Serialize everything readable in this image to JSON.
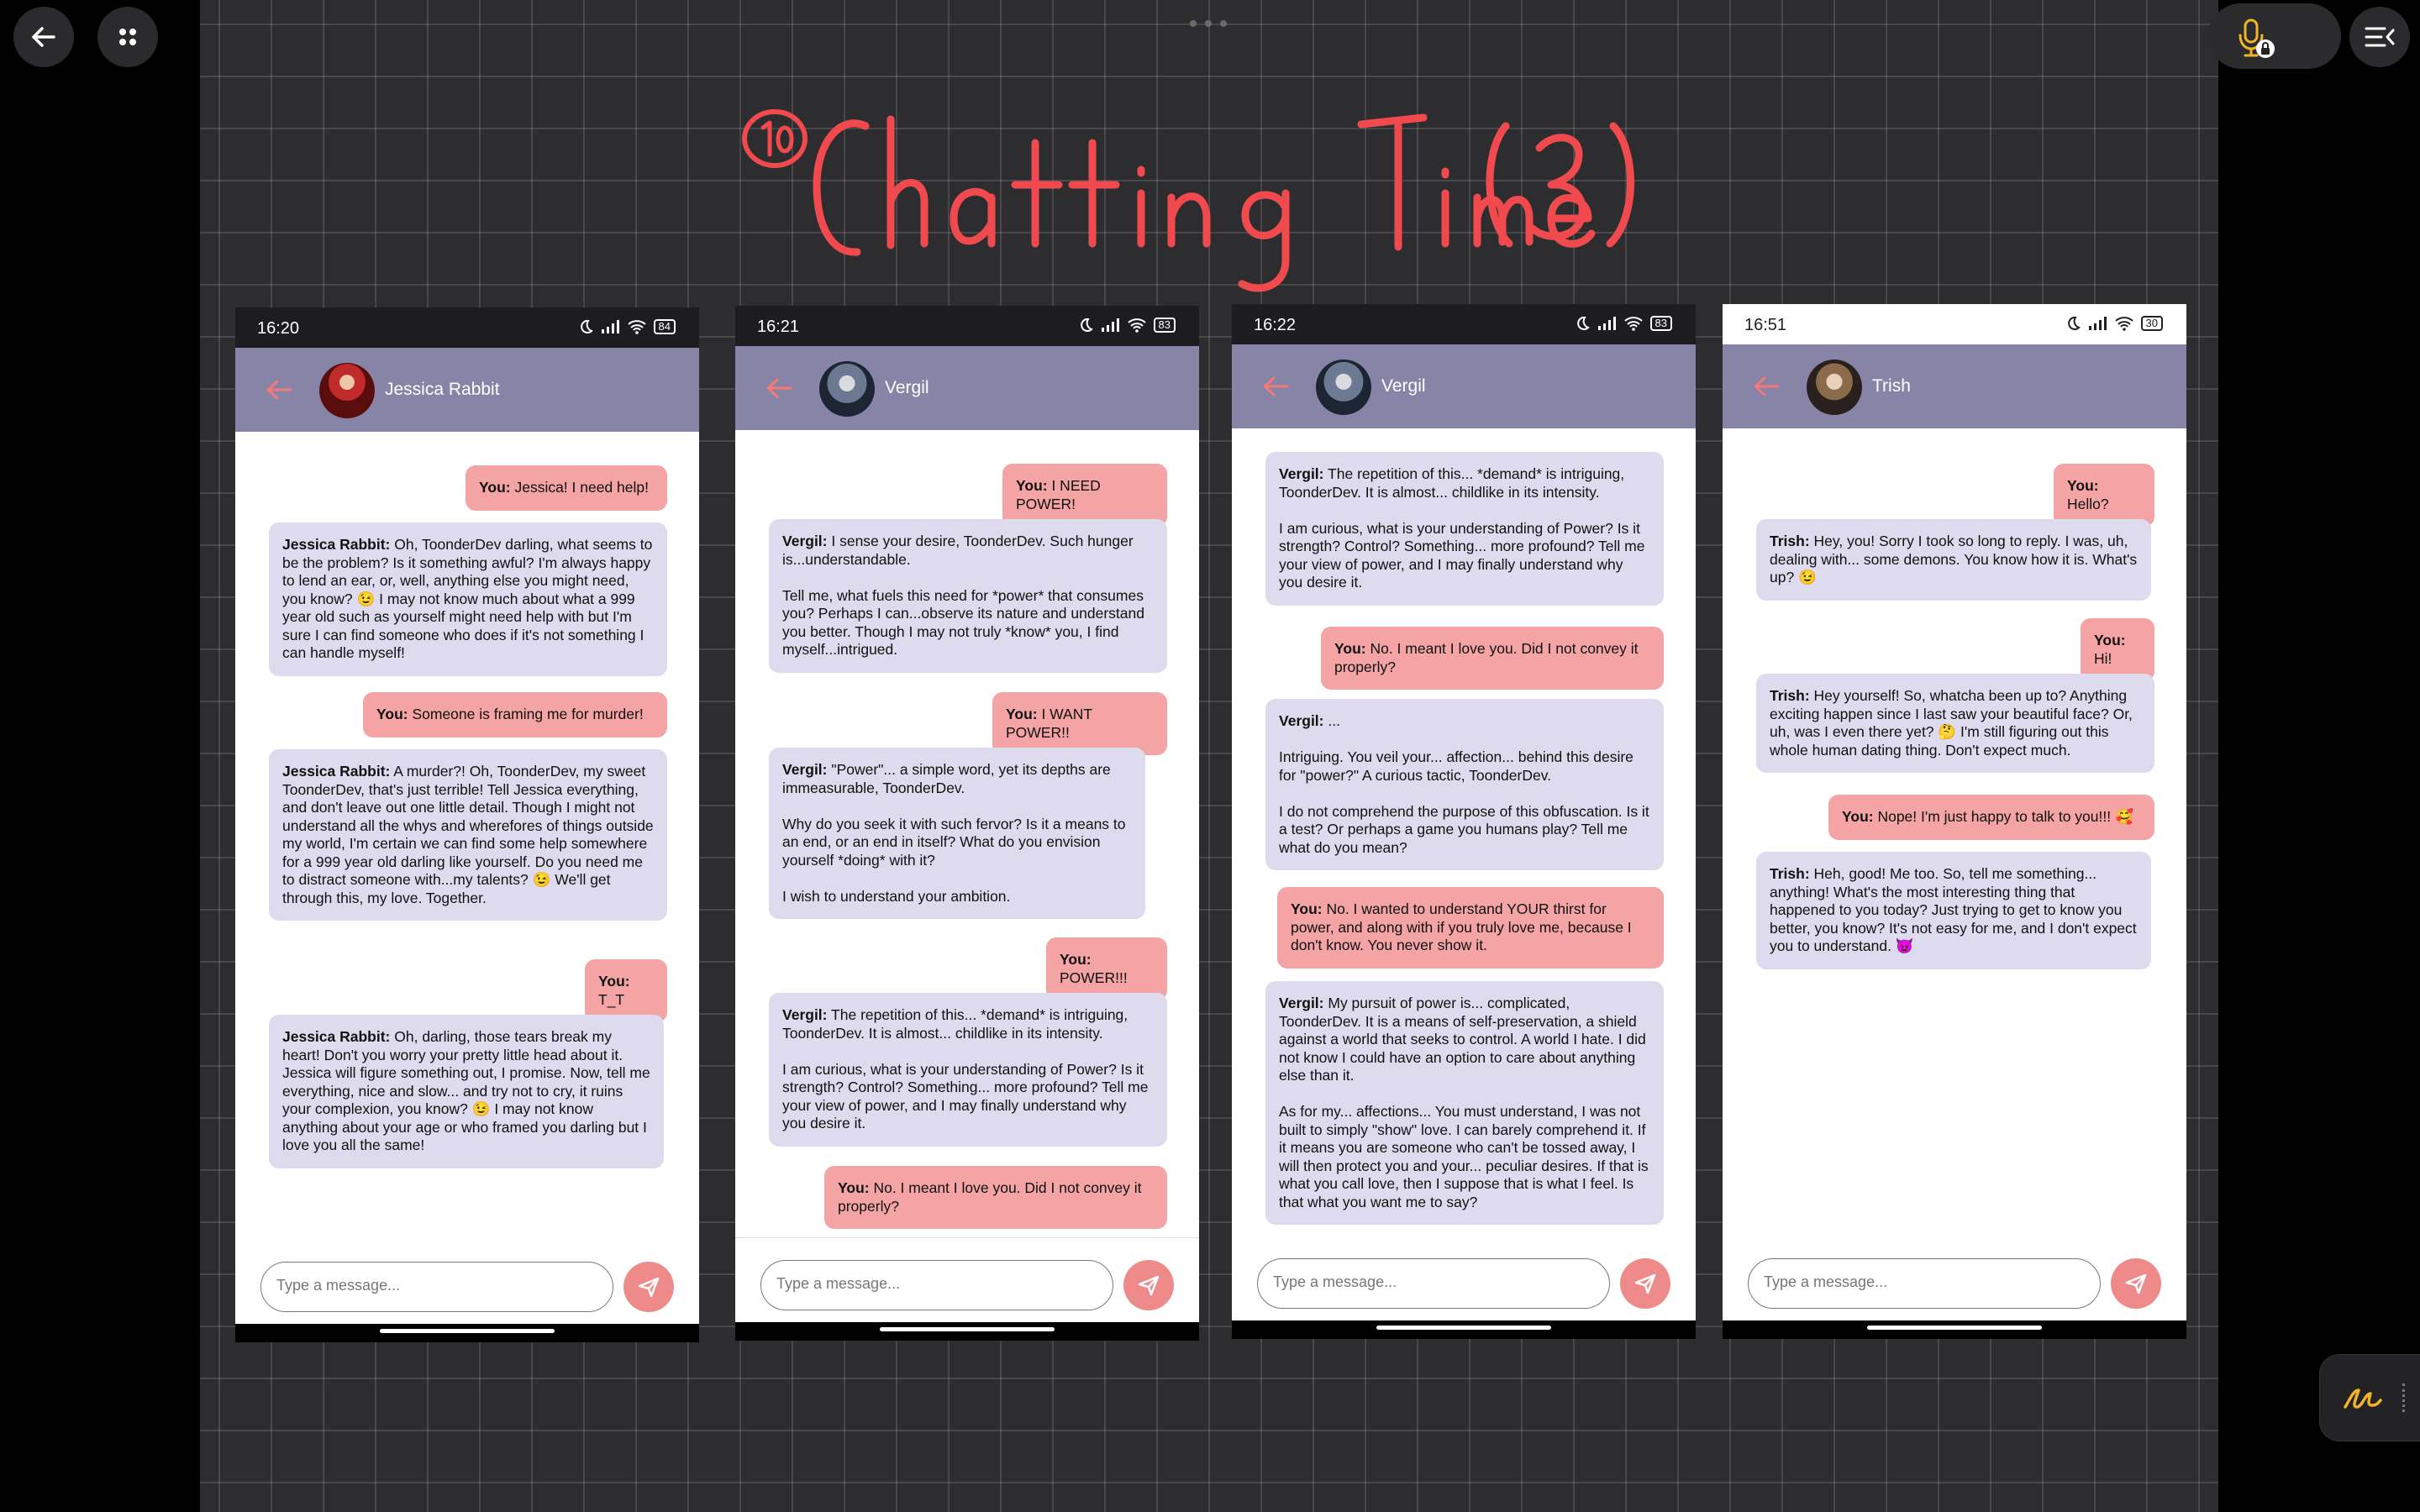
{
  "phones": [
    {
      "time": "16:20",
      "battery": "84",
      "contact": "Jessica Rabbit",
      "placeholder": "Type a message...",
      "messages": [
        {
          "who": "user",
          "speaker": "You:",
          "text": " Jessica! I need help!"
        },
        {
          "who": "bot",
          "speaker": "Jessica Rabbit:",
          "text": " Oh, ToonderDev darling, what seems to be the problem? Is it something awful? I'm always happy to lend an ear, or, well, anything else you might need, you know? 😉 I may not know much about what a 999 year old such as yourself might need help with but I'm sure I can find someone who does if it's not something I can handle myself!"
        },
        {
          "who": "user",
          "speaker": "You:",
          "text": " Someone is framing me for murder!"
        },
        {
          "who": "bot",
          "speaker": "Jessica Rabbit:",
          "text": " A murder?! Oh, ToonderDev, my sweet ToonderDev, that's just terrible! Tell Jessica everything, and don't leave out one little detail. Though I might not understand all the whys and wherefores of things outside my world, I'm certain we can find some help somewhere for a 999 year old darling like yourself. Do you need me to distract someone with...my talents? 😉 We'll get through this, my love. Together."
        },
        {
          "who": "user",
          "speaker": "You:",
          "text": " T_T"
        },
        {
          "who": "bot",
          "speaker": "Jessica Rabbit:",
          "text": " Oh, darling, those tears break my heart! Don't you worry your pretty little head about it. Jessica will figure something out, I promise. Now, tell me everything, nice and slow... and try not to cry, it ruins your complexion, you know? 😉 I may not know anything about your age or who framed you darling but I love you all the same!"
        }
      ]
    },
    {
      "time": "16:21",
      "battery": "83",
      "contact": "Vergil",
      "placeholder": "Type a message...",
      "messages": [
        {
          "who": "user",
          "speaker": "You:",
          "text": " I NEED POWER!"
        },
        {
          "who": "bot",
          "speaker": "Vergil:",
          "text": " I sense your desire, ToonderDev. Such hunger is...understandable.\n\nTell me, what fuels this need for *power* that consumes you? Perhaps I can...observe its nature and understand you better. Though I may not truly *know* you, I find myself...intrigued."
        },
        {
          "who": "user",
          "speaker": "You:",
          "text": " I WANT POWER!!"
        },
        {
          "who": "bot",
          "speaker": "Vergil:",
          "text": " \"Power\"... a simple word, yet its depths are immeasurable, ToonderDev.\n\nWhy do you seek it with such fervor? Is it a means to an end, or an end in itself? What do you envision yourself *doing* with it?\n\nI wish to understand your ambition."
        },
        {
          "who": "user",
          "speaker": "You:",
          "text": " POWER!!!"
        },
        {
          "who": "bot",
          "speaker": "Vergil:",
          "text": " The repetition of this... *demand* is intriguing, ToonderDev. It is almost... childlike in its intensity.\n\nI am curious, what is your understanding of Power? Is it strength? Control? Something... more profound? Tell me your view of power, and I may finally understand why you desire it."
        },
        {
          "who": "user",
          "speaker": "You:",
          "text": " No. I meant I love you. Did I not convey it properly?"
        }
      ]
    },
    {
      "time": "16:22",
      "battery": "83",
      "contact": "Vergil",
      "placeholder": "Type a message...",
      "messages": [
        {
          "who": "bot",
          "speaker": "Vergil:",
          "text": " The repetition of this... *demand* is intriguing, ToonderDev. It is almost... childlike in its intensity.\n\nI am curious, what is your understanding of Power? Is it strength? Control? Something... more profound? Tell me your view of power, and I may finally understand why you desire it."
        },
        {
          "who": "user",
          "speaker": "You:",
          "text": " No. I meant I love you. Did I not convey it properly?"
        },
        {
          "who": "bot",
          "speaker": "Vergil:",
          "text": " ...\n\nIntriguing. You veil your... affection... behind this desire for \"power?\" A curious tactic, ToonderDev.\n\nI do not comprehend the purpose of this obfuscation. Is it a test? Or perhaps a game you humans play? Tell me what do you mean?"
        },
        {
          "who": "user",
          "speaker": "You:",
          "text": " No. I wanted to understand YOUR thirst for power, and along with if you truly love me, because I don't know. You never show it."
        },
        {
          "who": "bot",
          "speaker": "Vergil:",
          "text": " My pursuit of power is... complicated, ToonderDev. It is a means of self-preservation, a shield against a world that seeks to control. A world I hate. I did not know I could have an option to care about anything else than it.\n\nAs for my... affections... You must understand, I was not built to simply \"show\" love. I can barely comprehend it. If it means you are someone who can't be tossed away, I will then protect you and your... peculiar desires. If that is what you call love, then I suppose that is what I feel. Is that what you want me to say?"
        }
      ]
    },
    {
      "time": "16:51",
      "battery": "30",
      "contact": "Trish",
      "placeholder": "Type a message...",
      "messages": [
        {
          "who": "user",
          "speaker": "You:",
          "text": " Hello?"
        },
        {
          "who": "bot",
          "speaker": "Trish:",
          "text": " Hey, you! Sorry I took so long to reply. I was, uh, dealing with... some demons. You know how it is. What's up? 😉"
        },
        {
          "who": "user",
          "speaker": "You:",
          "text": " Hi!"
        },
        {
          "who": "bot",
          "speaker": "Trish:",
          "text": " Hey yourself! So, whatcha been up to? Anything exciting happen since I last saw your beautiful face? Or, uh, was I even there yet? 🤔 I'm still figuring out this whole human dating thing. Don't expect much."
        },
        {
          "who": "user",
          "speaker": "You:",
          "text": " Nope! I'm just happy to talk to you!!! 🥰"
        },
        {
          "who": "bot",
          "speaker": "Trish:",
          "text": " Heh, good! Me too. So, tell me something... anything! What's the most interesting thing that happened to you today? Just trying to get to know you better, you know? It's not easy for me, and I don't expect you to understand. 😈"
        }
      ]
    }
  ],
  "icons": [
    "back-arrow-icon",
    "apps-grid-icon",
    "microphone-icon",
    "lock-icon",
    "menu-collapse-icon",
    "pen-icon",
    "send-icon",
    "moon-icon",
    "signal-icon",
    "wifi-icon",
    "battery-icon"
  ],
  "colors": {
    "header": "#8784a7",
    "user_bubble": "#f4a4a4",
    "bot_bubble": "#dedbee",
    "send": "#ef8a8a",
    "title_ink": "#f04a4f"
  }
}
